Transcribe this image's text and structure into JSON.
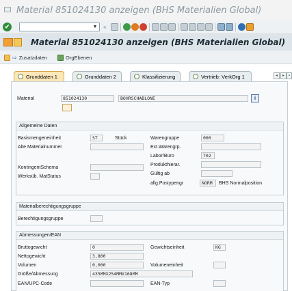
{
  "window": {
    "title": "Material 851024130 anzeigen (BHS Materialien Global)"
  },
  "toolbar": {
    "command_value": "",
    "check_icon": "check-icon"
  },
  "header": {
    "title": "Material 851024130 anzeigen (BHS Materialien Global)"
  },
  "app_toolbar": {
    "zusatzdaten": "Zusatzdaten",
    "orgebenen": "OrgEbenen"
  },
  "tabs": [
    {
      "label": "Grunddaten 1"
    },
    {
      "label": "Grunddaten 2"
    },
    {
      "label": "Klassifizierung"
    },
    {
      "label": "Vertrieb: VerkOrg 1"
    }
  ],
  "material": {
    "label": "Material",
    "number": "851024130",
    "description": "BOHRSCHABLONE"
  },
  "allgemeine": {
    "title": "Allgemeine Daten",
    "basismengeneinheit_label": "Basismengeneinheit",
    "basismengeneinheit_value": "ST",
    "basismengeneinheit_text": "Stück",
    "alte_materialnummer_label": "Alte Materialnummer",
    "alte_materialnummer_value": "",
    "kontingent_label": "KontingentSchema",
    "kontingent_value": "",
    "werksueb_label": "Werksüb. MatStatus",
    "werksueb_value": "",
    "warengruppe_label": "Warengruppe",
    "warengruppe_value": "000",
    "ext_warengrp_label": "Ext.Warengrp.",
    "ext_warengrp_value": "",
    "labor_label": "Labor/Büro",
    "labor_value": "T02",
    "produkthierar_label": "Produkthierar.",
    "produkthierar_value": "",
    "gueltig_ab_label": "Gültig ab",
    "gueltig_ab_value": "",
    "postypengr_label": "allg.Postypengr",
    "postypengr_value": "NORM",
    "postypengr_text": "BHS Normalposition"
  },
  "berechtigung": {
    "title": "Materialberechtigungsgruppe",
    "label": "Berechtigungsgruppe",
    "value": ""
  },
  "abmessungen": {
    "title": "Abmessungen/EAN",
    "bruttogewicht_label": "Bruttogewicht",
    "bruttogewicht_value": "0",
    "nettogewicht_label": "Nettogewicht",
    "nettogewicht_value": "3,800",
    "volumen_label": "Volumen",
    "volumen_value": "0,000",
    "groesse_label": "Größe/Abmessung",
    "groesse_value": "435MMX254MMX168MM",
    "ean_label": "EAN/UPC-Code",
    "ean_value": "",
    "gewichtseinheit_label": "Gewichtseinheit",
    "gewichtseinheit_value": "KG",
    "volumeneinheit_label": "Volumeneinheit",
    "volumeneinheit_value": "",
    "ean_typ_label": "EAN-Typ",
    "ean_typ_value": ""
  }
}
